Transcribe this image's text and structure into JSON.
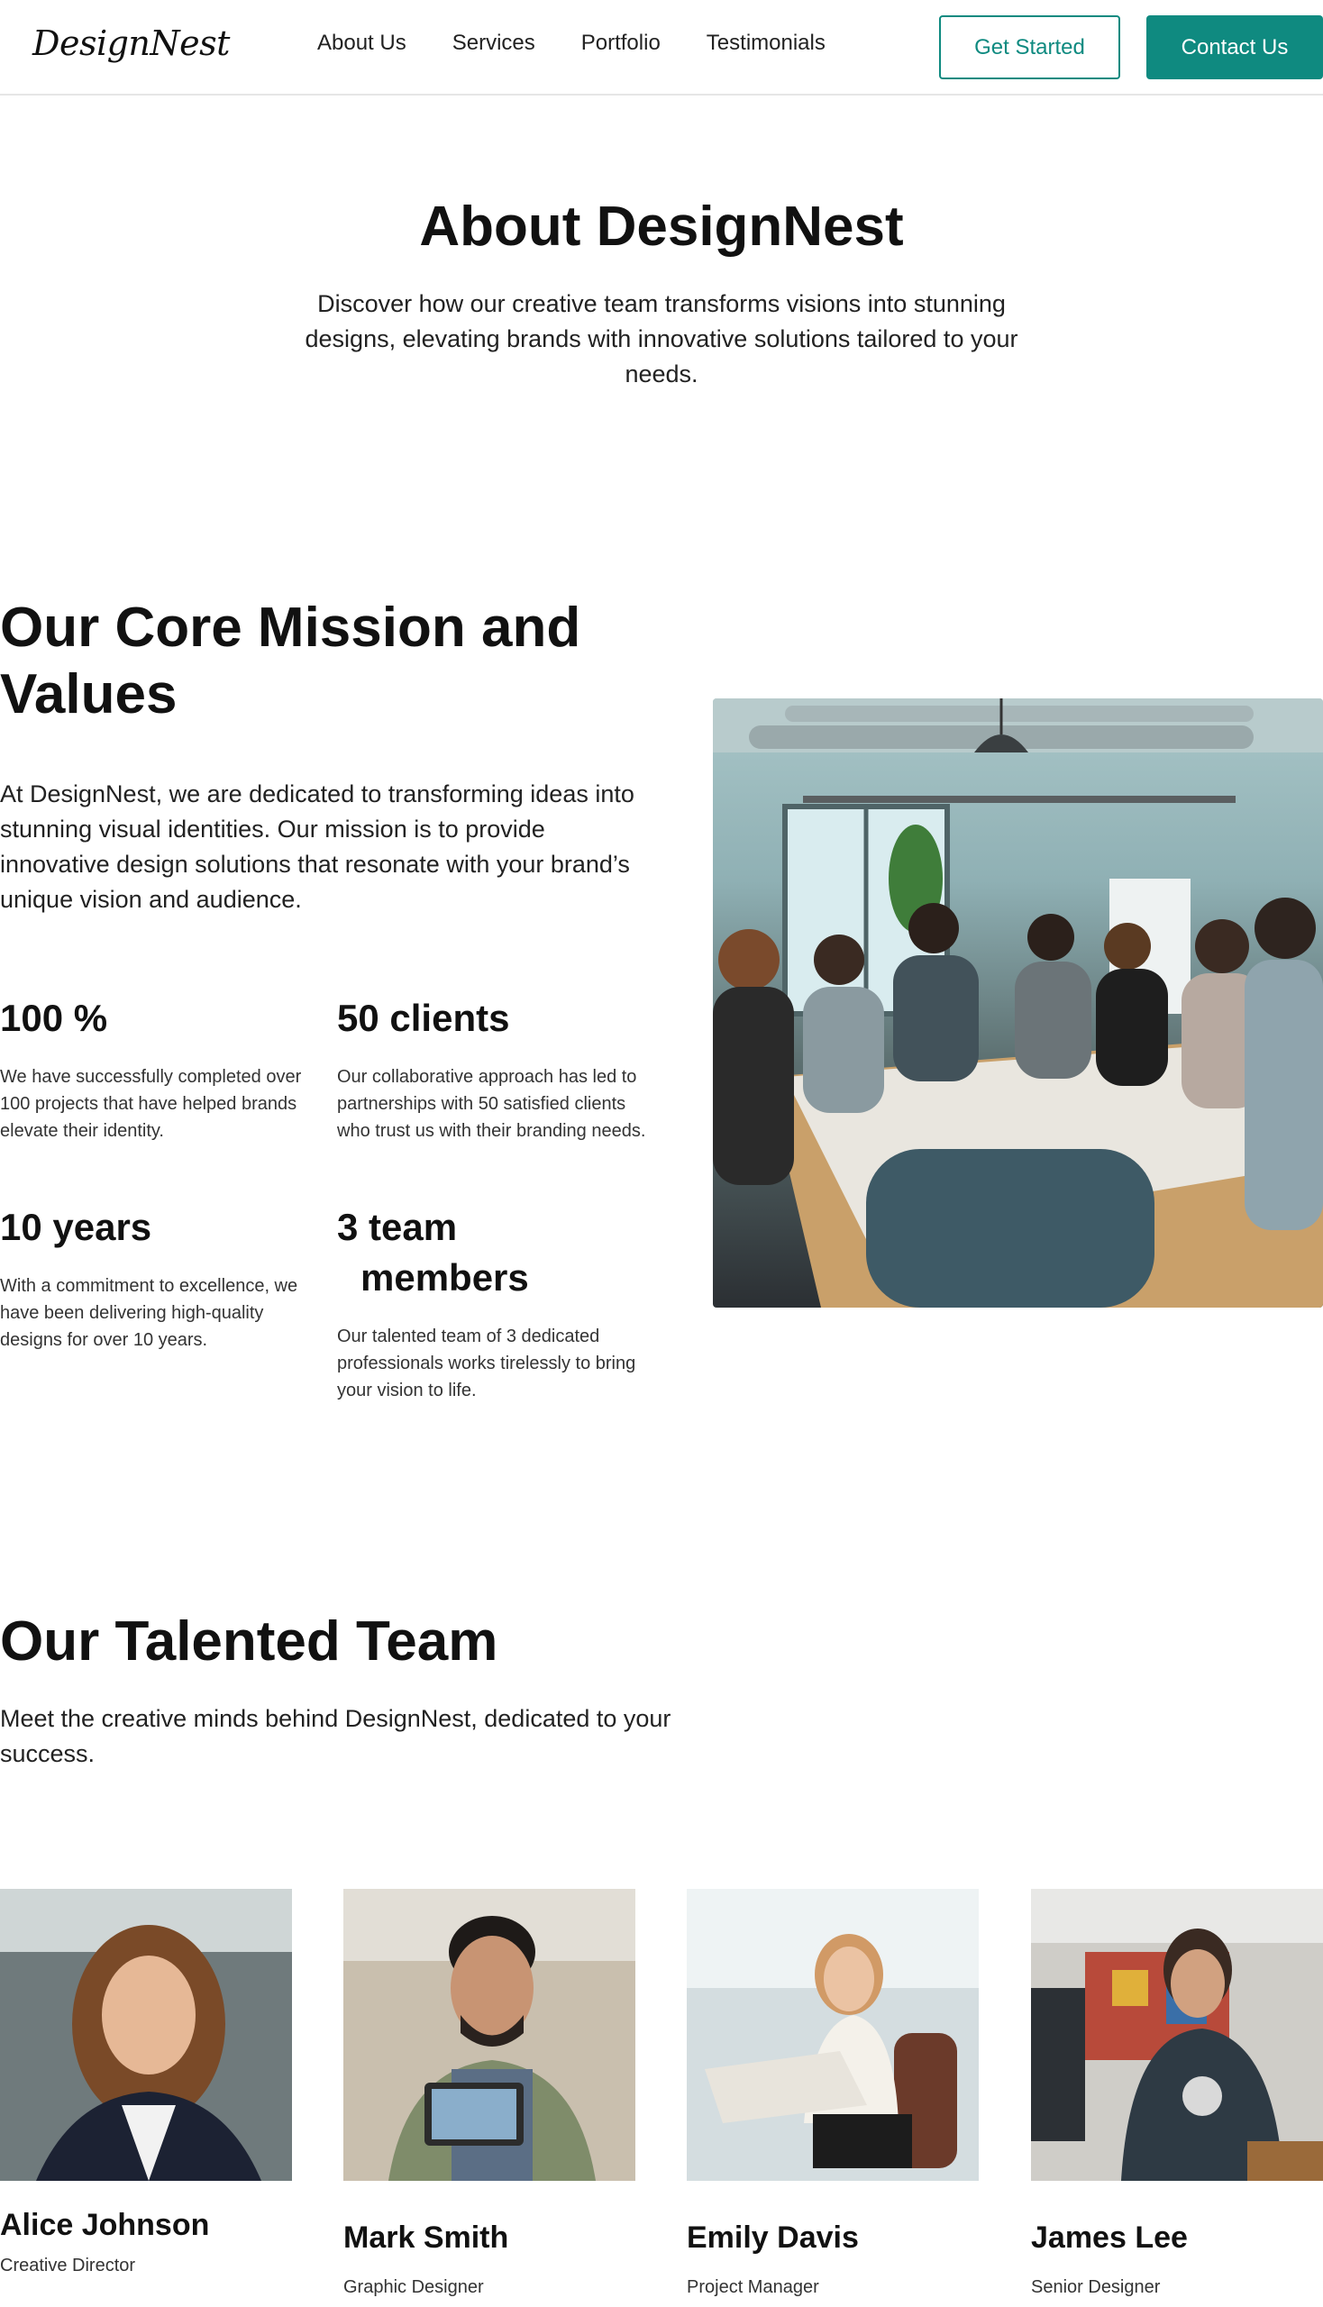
{
  "header": {
    "logo": "DesignNest",
    "nav": [
      "About Us",
      "Services",
      "Portfolio",
      "Testimonials"
    ],
    "get_started": "Get Started",
    "contact": "Contact Us",
    "accent_color": "#0f8a80"
  },
  "hero": {
    "title": "About DesignNest",
    "subtitle": "Discover how our creative team transforms visions into stunning designs, elevating brands with innovative solutions tailored to your needs."
  },
  "mission": {
    "title": "Our Core Mission and Values",
    "text": "At DesignNest, we are dedicated to transforming ideas into stunning visual identities. Our mission is to provide innovative design solutions that resonate with your brand’s unique vision and audience.",
    "stats": [
      {
        "value": "100 %",
        "text": "We have successfully completed over 100 projects that have helped brands elevate their identity."
      },
      {
        "value": "50 clients",
        "text": "Our collaborative approach has led to partnerships with 50 satisfied clients who trust us with their branding needs."
      },
      {
        "value": "10 years",
        "text": "With a commitment to excellence, we have been delivering high-quality designs for over 10 years."
      },
      {
        "value_line1": "3 team",
        "value_line2": "members",
        "text": "Our talented team of 3 dedicated professionals works tirelessly to bring your vision to life."
      }
    ]
  },
  "team": {
    "title": "Our Talented Team",
    "subtitle": "Meet the creative minds behind DesignNest, dedicated to your success.",
    "members": [
      {
        "name": "Alice Johnson",
        "role": "Creative Director"
      },
      {
        "name": "Mark Smith",
        "role": "Graphic Designer"
      },
      {
        "name": "Emily Davis",
        "role": "Project Manager"
      },
      {
        "name": "James Lee",
        "role": "Senior Designer"
      }
    ]
  }
}
